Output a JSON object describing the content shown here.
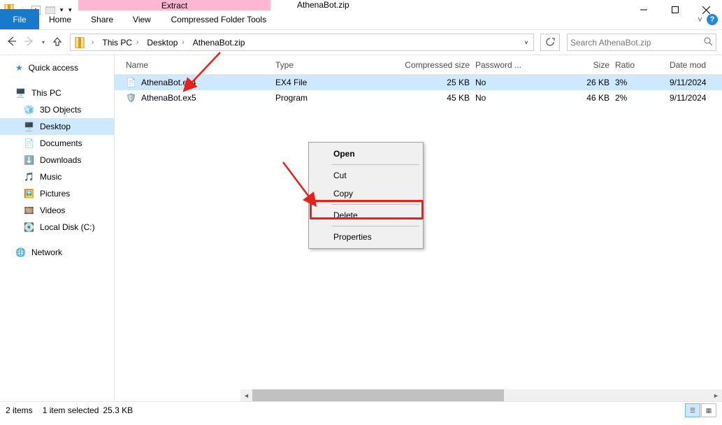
{
  "title": "AthenaBot.zip",
  "extract_tab": {
    "label": "Extract",
    "group_label": "Compressed Folder Tools"
  },
  "ribbon": {
    "file": "File",
    "home": "Home",
    "share": "Share",
    "view": "View",
    "help_caret": "˅"
  },
  "breadcrumbs": [
    "This PC",
    "Desktop",
    "AthenaBot.zip"
  ],
  "search_placeholder": "Search AthenaBot.zip",
  "sidebar": {
    "quick_access": "Quick access",
    "this_pc": "This PC",
    "items": [
      "3D Objects",
      "Desktop",
      "Documents",
      "Downloads",
      "Music",
      "Pictures",
      "Videos",
      "Local Disk (C:)"
    ],
    "network": "Network",
    "icons": {
      "quick_access": "★",
      "this_pc": "🖥️",
      "item0": "🧊",
      "item1": "🖥️",
      "item2": "📄",
      "item3": "⬇️",
      "item4": "🎵",
      "item5": "🖼️",
      "item6": "🎞️",
      "item7": "💽",
      "network": "🌐"
    }
  },
  "columns": {
    "name": "Name",
    "type": "Type",
    "comp": "Compressed size",
    "pass": "Password ...",
    "size": "Size",
    "ratio": "Ratio",
    "date": "Date mod"
  },
  "files": [
    {
      "icon": "📄",
      "name": "AthenaBot.ex4",
      "type": "EX4 File",
      "comp": "25 KB",
      "pass": "No",
      "size": "26 KB",
      "ratio": "3%",
      "date": "9/11/2024",
      "selected": true
    },
    {
      "icon": "🛡️",
      "name": "AthenaBot.ex5",
      "type": "Program",
      "comp": "45 KB",
      "pass": "No",
      "size": "46 KB",
      "ratio": "2%",
      "date": "9/11/2024",
      "selected": false
    }
  ],
  "context_menu": {
    "open": "Open",
    "cut": "Cut",
    "copy": "Copy",
    "delete": "Delete",
    "properties": "Properties"
  },
  "status": {
    "items": "2 items",
    "selected": "1 item selected",
    "size": "25.3 KB"
  }
}
